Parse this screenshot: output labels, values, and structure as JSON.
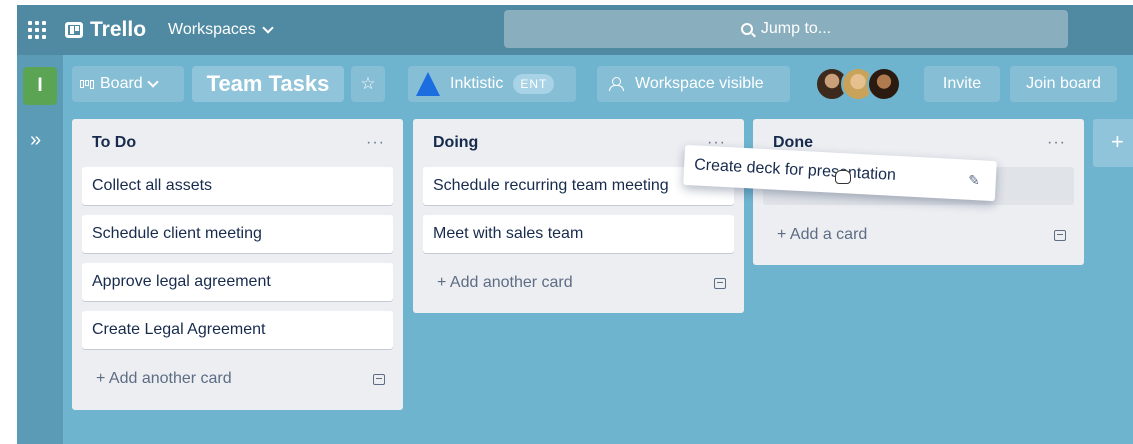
{
  "topnav": {
    "brand": "Trello",
    "workspaces_label": "Workspaces",
    "search_placeholder": "Jump to..."
  },
  "rail": {
    "workspace_initial": "I",
    "expand_glyph": "»"
  },
  "board_header": {
    "view_label": "Board",
    "board_title": "Team Tasks",
    "org_name": "Inktistic",
    "org_badge": "ENT",
    "visibility_label": "Workspace visible",
    "invite_label": "Invite",
    "join_label": "Join board"
  },
  "lists": [
    {
      "title": "To Do",
      "cards": [
        "Collect all assets",
        "Schedule client meeting",
        "Approve legal agreement",
        "Create Legal Agreement"
      ],
      "add_label": "+ Add another card"
    },
    {
      "title": "Doing",
      "cards": [
        "Schedule recurring team meeting",
        "Meet with sales team"
      ],
      "add_label": "+ Add another card"
    },
    {
      "title": "Done",
      "cards": [],
      "add_label": "+ Add a card"
    }
  ],
  "dragged_card": {
    "text": "Create deck for presentation"
  },
  "add_list_glyph": "+",
  "list_menu_glyph": "···",
  "icons": {
    "apps": "apps-grid-icon",
    "search": "search-icon",
    "star": "star-icon",
    "visibility": "people-icon",
    "template": "card-template-icon",
    "edit": "pencil-icon"
  },
  "colors": {
    "board_bg": "#6fb4cf",
    "nav_bg": "#4f8aa2",
    "workspace_badge": "#5aa454",
    "atlassian_blue": "#1b6de0"
  }
}
